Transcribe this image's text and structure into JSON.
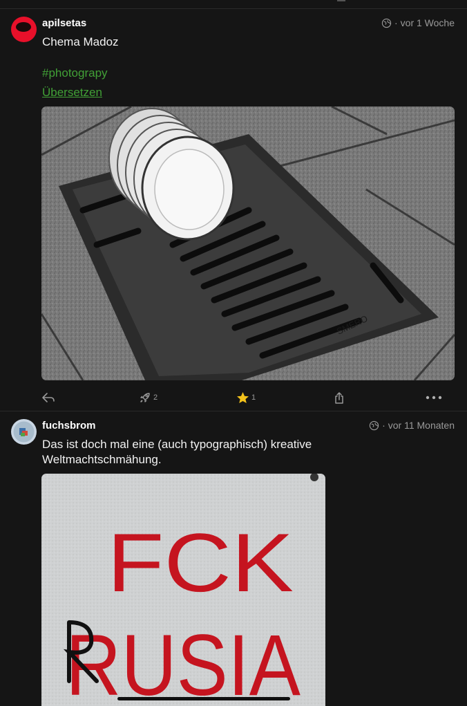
{
  "posts": [
    {
      "author": "apilsetas",
      "time": "vor 1 Woche",
      "text": "Chema Madoz",
      "hashtag": "#photograpy",
      "translate_label": "Übersetzen",
      "image": "black-and-white photo of stacked plates on a storm drain grate",
      "actions": {
        "reply_icon": "reply-icon",
        "boost_icon": "rocket-icon",
        "boost_count": "2",
        "favourite_icon": "star-icon",
        "favourite_count": "1",
        "share_icon": "share-icon",
        "more_icon": "more-icon"
      }
    },
    {
      "author": "fuchsbrom",
      "time": "vor 11 Monaten",
      "text_line1": "Das ist doch mal eine (auch typographisch) kreative",
      "text_line2": "Weltmachtschmähung.",
      "image_text_top": "FCK",
      "image_text_bottom": "RUSIA",
      "image": "graffiti on grey wall"
    }
  ],
  "colors": {
    "accent": "#41a036",
    "background": "#151515",
    "star": "#f3c21b",
    "graffiti_red": "#c5141f"
  }
}
